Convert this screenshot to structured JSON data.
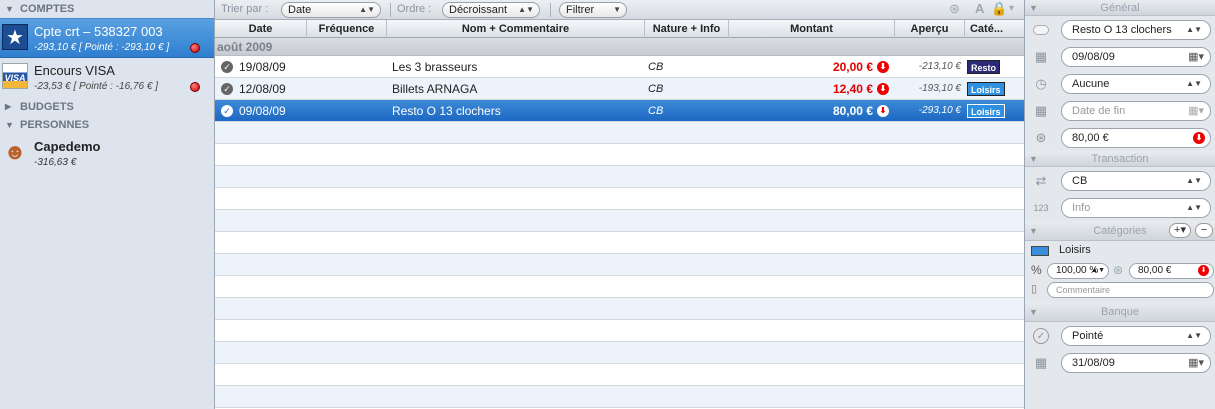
{
  "sidebar": {
    "comptes_header": "COMPTES",
    "accounts": [
      {
        "name": "Cpte crt – 538327 003",
        "sub": "-293,10 € [ Pointé : -293,10 € ]"
      },
      {
        "name": "Encours VISA",
        "sub": "-23,53 € [ Pointé : -16,76 € ]",
        "logo": "VISA"
      }
    ],
    "budgets_header": "BUDGETS",
    "personnes_header": "PERSONNES",
    "person": {
      "name": "Capedemo",
      "sub": "-316,63 €"
    }
  },
  "toolbar": {
    "sort_label": "Trier par :",
    "sort_value": "Date",
    "order_label": "Ordre :",
    "order_value": "Décroissant",
    "filter_label": "Filtrer",
    "font_letter": "A"
  },
  "table": {
    "headers": [
      "Date",
      "Fréquence",
      "Nom + Commentaire",
      "Nature + Info",
      "Montant",
      "Aperçu",
      "Caté..."
    ],
    "group": "août 2009",
    "rows": [
      {
        "date": "19/08/09",
        "name": "Les 3 brasseurs",
        "nature": "CB",
        "amount": "20,00 €",
        "apercu": "-213,10 €",
        "cat": "Resto",
        "cat_color": "#2b2a78"
      },
      {
        "date": "12/08/09",
        "name": "Billets ARNAGA",
        "nature": "CB",
        "amount": "12,40 €",
        "apercu": "-193,10 €",
        "cat": "Loisirs",
        "cat_color": "#2f8fe0"
      },
      {
        "date": "09/08/09",
        "name": "Resto O 13 clochers",
        "nature": "CB",
        "amount": "80,00 €",
        "apercu": "-293,10 €",
        "cat": "Loisirs",
        "cat_color": "#2f8fe0"
      }
    ]
  },
  "inspector": {
    "general_header": "Général",
    "payee": "Resto O 13 clochers",
    "date": "09/08/09",
    "repeat": "Aucune",
    "end_date_placeholder": "Date de fin",
    "amount": "80,00 €",
    "transaction_header": "Transaction",
    "type": "CB",
    "info_placeholder": "Info",
    "categories_header": "Catégories",
    "category_name": "Loisirs",
    "category_color": "#3a8fdc",
    "percent": "100,00 %",
    "cat_amount": "80,00 €",
    "comment_placeholder": "Commentaire",
    "banque_header": "Banque",
    "status": "Pointé",
    "bank_date": "31/08/09"
  }
}
